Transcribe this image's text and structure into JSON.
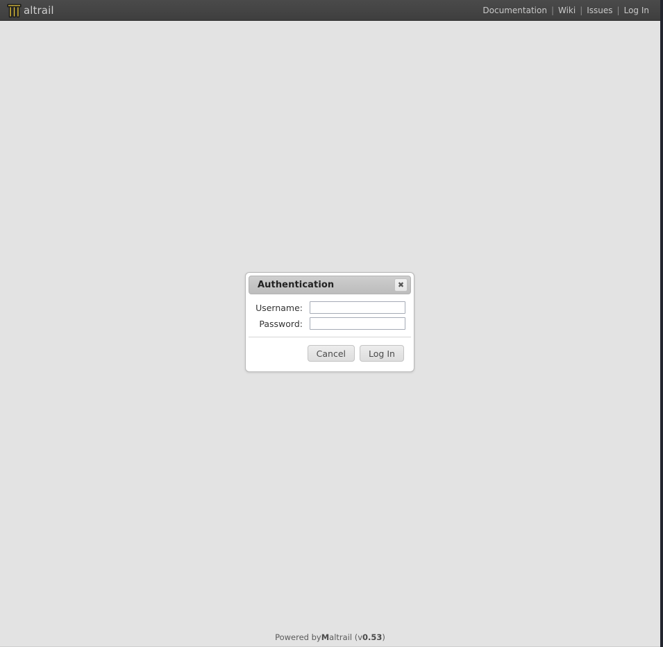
{
  "header": {
    "brand_name": "altrail",
    "brand_logo_icon": "maltrail-m-logo-icon",
    "nav": [
      {
        "label": "Documentation"
      },
      {
        "label": "Wiki"
      },
      {
        "label": "Issues"
      },
      {
        "label": "Log In"
      }
    ],
    "separator": "|"
  },
  "dialog": {
    "title": "Authentication",
    "close_icon": "close-icon",
    "close_glyph": "✖",
    "fields": [
      {
        "label": "Username:",
        "value": "",
        "placeholder": "",
        "type": "text",
        "name": "username"
      },
      {
        "label": "Password:",
        "value": "",
        "placeholder": "",
        "type": "password",
        "name": "password"
      }
    ],
    "buttons": {
      "cancel_label": "Cancel",
      "login_label": "Log In"
    }
  },
  "footer": {
    "prefix": "Powered by ",
    "brand_bold": "M",
    "brand_rest": "altrail (v",
    "version": "0.53",
    "suffix": ")"
  },
  "colors": {
    "topbar": "#444444",
    "page_background": "#e3e3e3",
    "logo_gold": "#e8c840",
    "nav_text": "#c9c9c9",
    "right_edge": "#23252e"
  }
}
